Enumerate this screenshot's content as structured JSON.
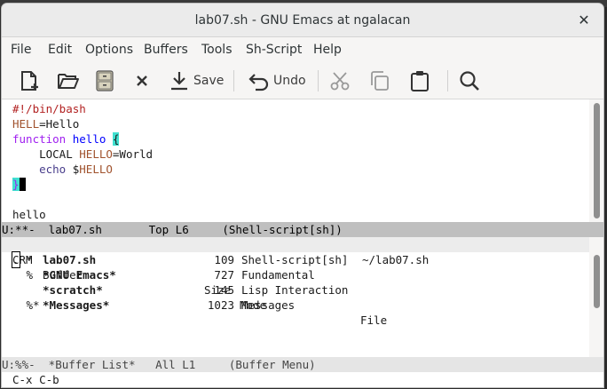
{
  "window": {
    "title": "lab07.sh - GNU Emacs at ngalacan",
    "close_glyph": "✕"
  },
  "menubar": [
    "File",
    "Edit",
    "Options",
    "Buffers",
    "Tools",
    "Sh-Script",
    "Help"
  ],
  "toolbar": {
    "save_label": "Save",
    "undo_label": "Undo"
  },
  "editor": {
    "lines": [
      {
        "parts": [
          {
            "text": "#!/bin/bash",
            "style": "comment"
          }
        ]
      },
      {
        "parts": [
          {
            "text": "HELL",
            "style": "var"
          },
          {
            "text": "=Hello",
            "style": "plain"
          }
        ]
      },
      {
        "parts": [
          {
            "text": "function",
            "style": "kw"
          },
          {
            "text": " ",
            "style": "plain"
          },
          {
            "text": "hello",
            "style": "fn"
          },
          {
            "text": " ",
            "style": "plain"
          },
          {
            "text": "{",
            "style": "paren"
          }
        ]
      },
      {
        "parts": [
          {
            "text": "    LOCAL ",
            "style": "plain"
          },
          {
            "text": "HELLO",
            "style": "var"
          },
          {
            "text": "=World",
            "style": "plain"
          }
        ]
      },
      {
        "parts": [
          {
            "text": "    ",
            "style": "plain"
          },
          {
            "text": "echo",
            "style": "builtin"
          },
          {
            "text": " $",
            "style": "plain"
          },
          {
            "text": "HELLO",
            "style": "var"
          }
        ]
      },
      {
        "parts": [
          {
            "text": "}",
            "style": "paren"
          },
          {
            "text": " ",
            "style": "cursor"
          }
        ]
      },
      {
        "parts": []
      },
      {
        "parts": [
          {
            "text": "hello",
            "style": "plain"
          }
        ]
      }
    ]
  },
  "modeline_top": "U:**-  lab07.sh       Top L6     (Shell-script[sh])",
  "buffer_list": {
    "headers": {
      "crm": "CRM",
      "buffer": "Buffer",
      "size": "Size",
      "mode": "Mode",
      "file": "File"
    },
    "rows": [
      {
        "crm_point": ".",
        "crm_rest": " *",
        "name": "lab07.sh",
        "size": "109",
        "mode": "Shell-script[sh]",
        "file": "~/lab07.sh"
      },
      {
        "crm_point": "",
        "crm_rest": " %",
        "name": "*GNU Emacs*",
        "size": "727",
        "mode": "Fundamental",
        "file": ""
      },
      {
        "crm_point": "",
        "crm_rest": "",
        "name": "*scratch*",
        "size": "145",
        "mode": "Lisp Interaction",
        "file": ""
      },
      {
        "crm_point": "",
        "crm_rest": " %*",
        "name": "*Messages*",
        "size": "1023",
        "mode": "Messages",
        "file": ""
      }
    ]
  },
  "modeline_bottom": "U:%%-  *Buffer List*   All L1     (Buffer Menu)",
  "minibuffer": "C-x C-b"
}
